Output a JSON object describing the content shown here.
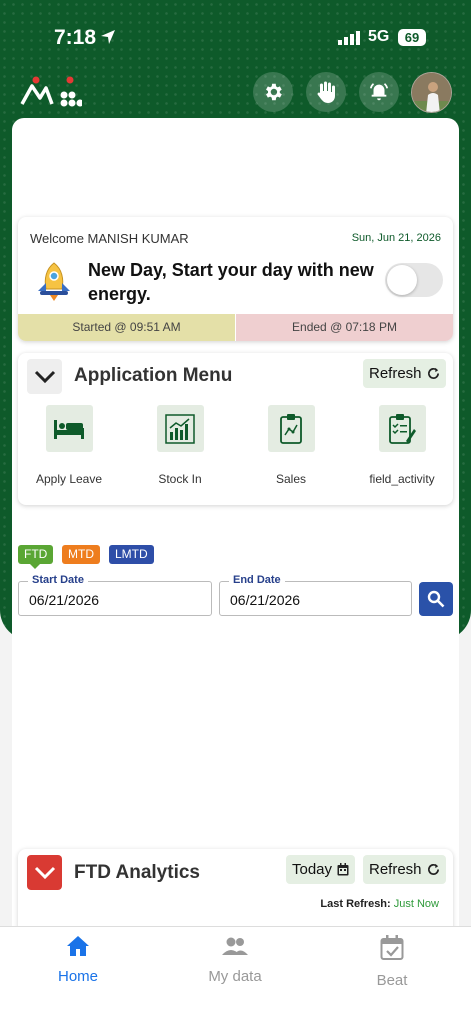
{
  "status_bar": {
    "time": "7:18",
    "network": "5G",
    "battery": "69"
  },
  "header": {
    "settings_icon": "gear-icon",
    "hand_icon": "hand-icon",
    "alarm_icon": "alarm-icon"
  },
  "welcome": {
    "greeting": "Welcome MANISH KUMAR",
    "date": "Sun, Jun 21, 2026",
    "message": "New Day, Start your day with new energy.",
    "started": "Started @ 09:51 AM",
    "ended": "Ended @ 07:18 PM",
    "toggle_on": false
  },
  "app_menu": {
    "title": "Application Menu",
    "refresh_label": "Refresh",
    "items": [
      {
        "label": "Apply Leave",
        "icon": "bed-icon"
      },
      {
        "label": "Stock In",
        "icon": "chart-icon"
      },
      {
        "label": "Sales",
        "icon": "clipboard-icon"
      },
      {
        "label": "field_activity",
        "icon": "checklist-icon"
      }
    ]
  },
  "filters": {
    "pills": [
      "FTD",
      "MTD",
      "LMTD"
    ],
    "start_label": "Start Date",
    "start_value": "06/21/2026",
    "end_label": "End Date",
    "end_value": "06/21/2026"
  },
  "analytics": {
    "title": "FTD Analytics",
    "today_label": "Today",
    "refresh_label": "Refresh",
    "last_refresh_label": "Last Refresh:",
    "last_refresh_value": "Just Now"
  },
  "bottom_nav": [
    {
      "label": "Home",
      "active": true
    },
    {
      "label": "My data",
      "active": false
    },
    {
      "label": "Beat",
      "active": false
    }
  ],
  "colors": {
    "brand_green": "#0e5a2a",
    "accent_blue": "#1a73e8",
    "inactive": "#999999"
  }
}
